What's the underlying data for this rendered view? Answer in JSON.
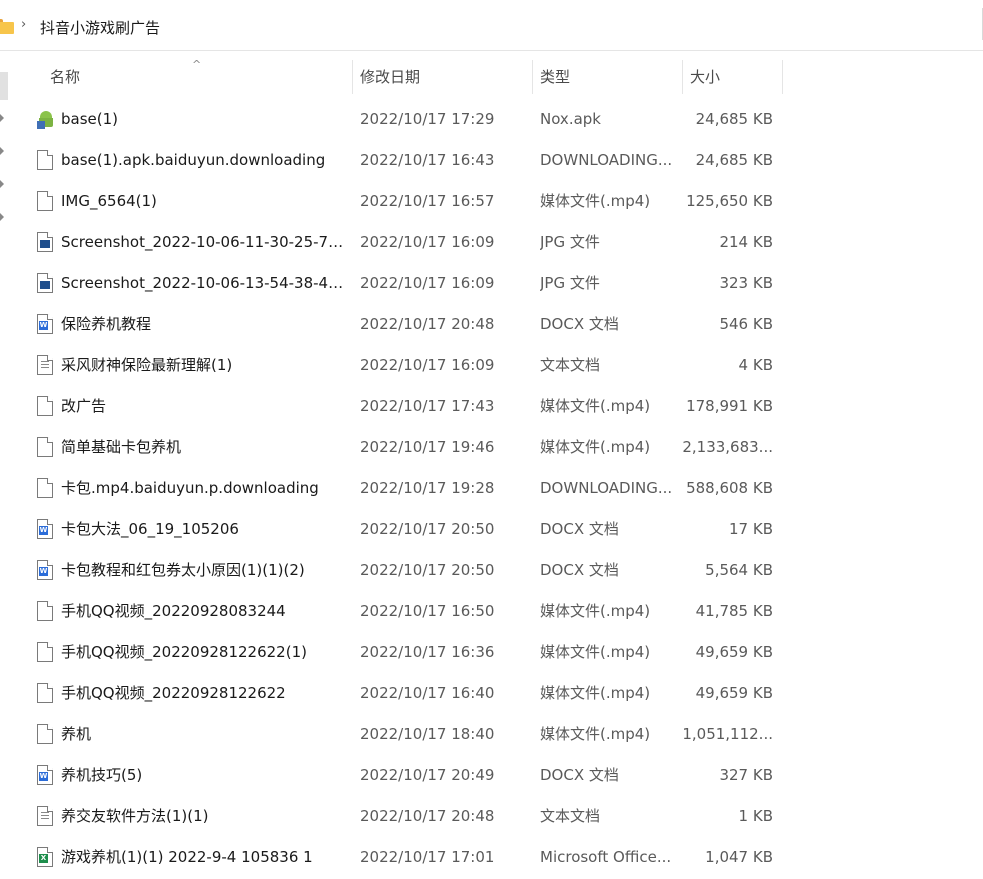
{
  "address": {
    "folder_icon": "folder-icon",
    "separator": "›",
    "current_folder": "抖音小游戏刷广告"
  },
  "columns": {
    "name": "名称",
    "date_modified": "修改日期",
    "type": "类型",
    "size": "大小"
  },
  "files": [
    {
      "name": "base(1)",
      "date": "2022/10/17 17:29",
      "type": "Nox.apk",
      "size": "24,685 KB",
      "icon": "apk"
    },
    {
      "name": "base(1).apk.baiduyun.downloading",
      "date": "2022/10/17 16:43",
      "type": "DOWNLOADING...",
      "size": "24,685 KB",
      "icon": "file"
    },
    {
      "name": "IMG_6564(1)",
      "date": "2022/10/17 16:57",
      "type": "媒体文件(.mp4)",
      "size": "125,650 KB",
      "icon": "file"
    },
    {
      "name": "Screenshot_2022-10-06-11-30-25-74...",
      "date": "2022/10/17 16:09",
      "type": "JPG 文件",
      "size": "214 KB",
      "icon": "jpg"
    },
    {
      "name": "Screenshot_2022-10-06-13-54-38-47...",
      "date": "2022/10/17 16:09",
      "type": "JPG 文件",
      "size": "323 KB",
      "icon": "jpg"
    },
    {
      "name": "保险养机教程",
      "date": "2022/10/17 20:48",
      "type": "DOCX 文档",
      "size": "546 KB",
      "icon": "docx"
    },
    {
      "name": "采风财神保险最新理解(1)",
      "date": "2022/10/17 16:09",
      "type": "文本文档",
      "size": "4 KB",
      "icon": "text"
    },
    {
      "name": "改广告",
      "date": "2022/10/17 17:43",
      "type": "媒体文件(.mp4)",
      "size": "178,991 KB",
      "icon": "file"
    },
    {
      "name": "简单基础卡包养机",
      "date": "2022/10/17 19:46",
      "type": "媒体文件(.mp4)",
      "size": "2,133,683...",
      "icon": "file"
    },
    {
      "name": "卡包.mp4.baiduyun.p.downloading",
      "date": "2022/10/17 19:28",
      "type": "DOWNLOADING...",
      "size": "588,608 KB",
      "icon": "file"
    },
    {
      "name": "卡包大法_06_19_105206",
      "date": "2022/10/17 20:50",
      "type": "DOCX 文档",
      "size": "17 KB",
      "icon": "docx"
    },
    {
      "name": "卡包教程和红包券太小原因(1)(1)(2)",
      "date": "2022/10/17 20:50",
      "type": "DOCX 文档",
      "size": "5,564 KB",
      "icon": "docx"
    },
    {
      "name": "手机QQ视频_20220928083244",
      "date": "2022/10/17 16:50",
      "type": "媒体文件(.mp4)",
      "size": "41,785 KB",
      "icon": "file"
    },
    {
      "name": "手机QQ视频_20220928122622(1)",
      "date": "2022/10/17 16:36",
      "type": "媒体文件(.mp4)",
      "size": "49,659 KB",
      "icon": "file"
    },
    {
      "name": "手机QQ视频_20220928122622",
      "date": "2022/10/17 16:40",
      "type": "媒体文件(.mp4)",
      "size": "49,659 KB",
      "icon": "file"
    },
    {
      "name": "养机",
      "date": "2022/10/17 18:40",
      "type": "媒体文件(.mp4)",
      "size": "1,051,112...",
      "icon": "file"
    },
    {
      "name": "养机技巧(5)",
      "date": "2022/10/17 20:49",
      "type": "DOCX 文档",
      "size": "327 KB",
      "icon": "docx"
    },
    {
      "name": "养交友软件方法(1)(1)",
      "date": "2022/10/17 20:48",
      "type": "文本文档",
      "size": "1 KB",
      "icon": "text"
    },
    {
      "name": "游戏养机(1)(1) 2022-9-4 105836 1",
      "date": "2022/10/17 17:01",
      "type": "Microsoft Office...",
      "size": "1,047 KB",
      "icon": "xls"
    }
  ]
}
